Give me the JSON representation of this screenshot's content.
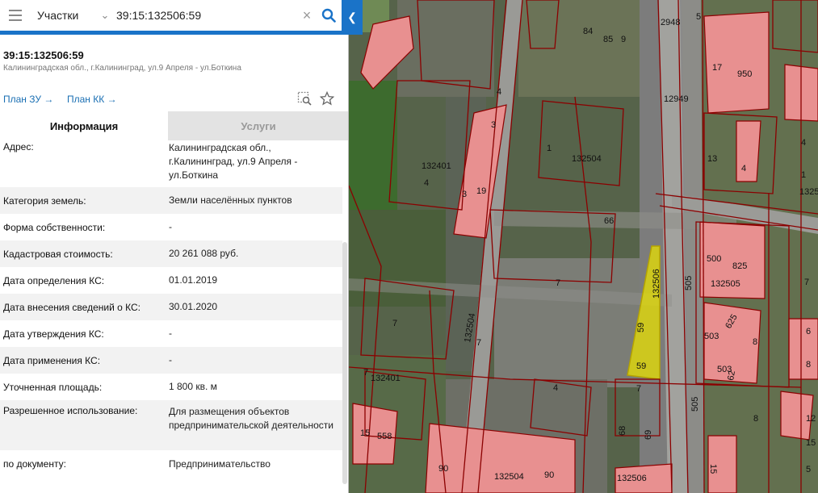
{
  "search": {
    "select_label": "Участки",
    "query": "39:15:132506:59"
  },
  "object": {
    "title": "39:15:132506:59",
    "address": "Калининградская обл., г.Калининград, ул.9 Апреля - ул.Боткина"
  },
  "links": {
    "plan_zu": "План ЗУ →",
    "plan_kk": "План КК →"
  },
  "tabs": [
    {
      "label": "Информация",
      "active": true
    },
    {
      "label": "Услуги",
      "active": false
    }
  ],
  "info_rows": [
    {
      "key": "Адрес:",
      "value": "Калининградская обл., г.Калининград, ул.9 Апреля - ул.Боткина"
    },
    {
      "key": "Категория земель:",
      "value": "Земли населённых пунктов"
    },
    {
      "key": "Форма собственности:",
      "value": "-"
    },
    {
      "key": "Кадастровая стоимость:",
      "value": "20 261 088 руб."
    },
    {
      "key": "Дата определения КС:",
      "value": "01.01.2019"
    },
    {
      "key": "Дата внесения сведений о КС:",
      "value": "30.01.2020"
    },
    {
      "key": "Дата утверждения КС:",
      "value": "-"
    },
    {
      "key": "Дата применения КС:",
      "value": "-"
    },
    {
      "key": "Уточненная площадь:",
      "value": "1 800 кв. м"
    },
    {
      "key": "Разрешенное использование:",
      "value": "Для размещения объектов предпринимательской деятельности"
    },
    {
      "key": "по документу:",
      "value": "Предпринимательство"
    }
  ],
  "map": {
    "labels": [
      "2948",
      "5",
      "84",
      "85",
      "9",
      "4",
      "3",
      "17",
      "950",
      "12949",
      "1",
      "132504",
      "132401",
      "4",
      "13",
      "4",
      "1325",
      "66",
      "3",
      "19",
      "500",
      "825",
      "132505",
      "7",
      "132506",
      "505",
      "59",
      "59",
      "7",
      "132504",
      "503",
      "625",
      "8",
      "7",
      "7",
      "503",
      "62",
      "132401",
      "7",
      "4",
      "505",
      "8",
      "15",
      "558",
      "132504",
      "90",
      "90",
      "68",
      "69",
      "132506",
      "15",
      "7",
      "6",
      "8",
      "4",
      "1",
      "12",
      "15",
      "5"
    ],
    "colors": {
      "parcel_line": "#8b0000",
      "building": "#e58d8d",
      "highlight": "#e8e000"
    }
  }
}
